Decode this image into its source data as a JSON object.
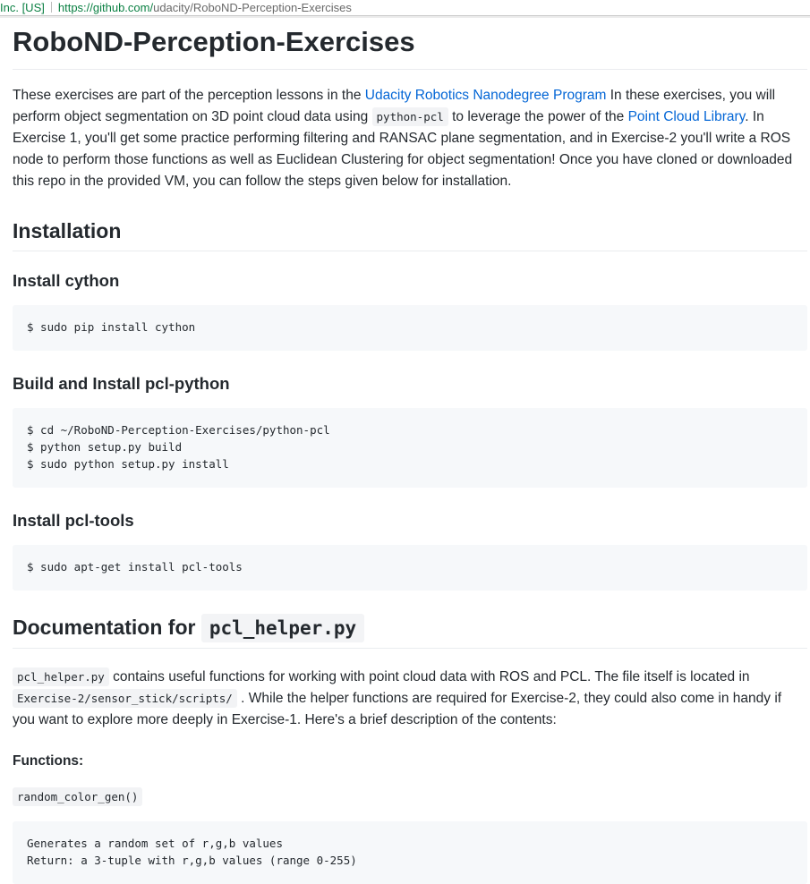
{
  "addressbar": {
    "ev_label": "Inc. [US]",
    "url_host": "https://github.com/",
    "url_path": "udacity/RoboND-Perception-Exercises"
  },
  "title": "RoboND-Perception-Exercises",
  "intro": {
    "t1": "These exercises are part of the perception lessons in the ",
    "link1": "Udacity Robotics Nanodegree Program",
    "t2": " In these exercises, you will perform object segmentation on 3D point cloud data using ",
    "code1": "python-pcl",
    "t3": " to leverage the power of the ",
    "link2": "Point Cloud Library",
    "t4": ". In Exercise 1, you'll get some practice performing filtering and RANSAC plane segmentation, and in Exercise-2 you'll write a ROS node to perform those functions as well as Euclidean Clustering for object segmentation! Once you have cloned or downloaded this repo in the provided VM, you can follow the steps given below for installation."
  },
  "installation": {
    "heading": "Installation",
    "cython_heading": "Install cython",
    "cython_code": "$ sudo pip install cython",
    "pcl_python_heading": "Build and Install pcl-python",
    "pcl_python_code": "$ cd ~/RoboND-Perception-Exercises/python-pcl\n$ python setup.py build\n$ sudo python setup.py install",
    "pcl_tools_heading": "Install pcl-tools",
    "pcl_tools_code": "$ sudo apt-get install pcl-tools"
  },
  "documentation": {
    "heading_text": "Documentation for ",
    "heading_code": "pcl_helper.py",
    "p_code1": "pcl_helper.py",
    "p_t1": " contains useful functions for working with point cloud data with ROS and PCL. The file itself is located in ",
    "p_code2": "Exercise-2/sensor_stick/scripts/",
    "p_t2": " . While the helper functions are required for Exercise-2, they could also come in handy if you want to explore more deeply in Exercise-1. Here's a brief description of the contents:",
    "functions_label": "Functions:",
    "func1_name": "random_color_gen()",
    "func1_desc": "Generates a random set of r,g,b values\nReturn: a 3-tuple with r,g,b values (range 0-255)"
  }
}
